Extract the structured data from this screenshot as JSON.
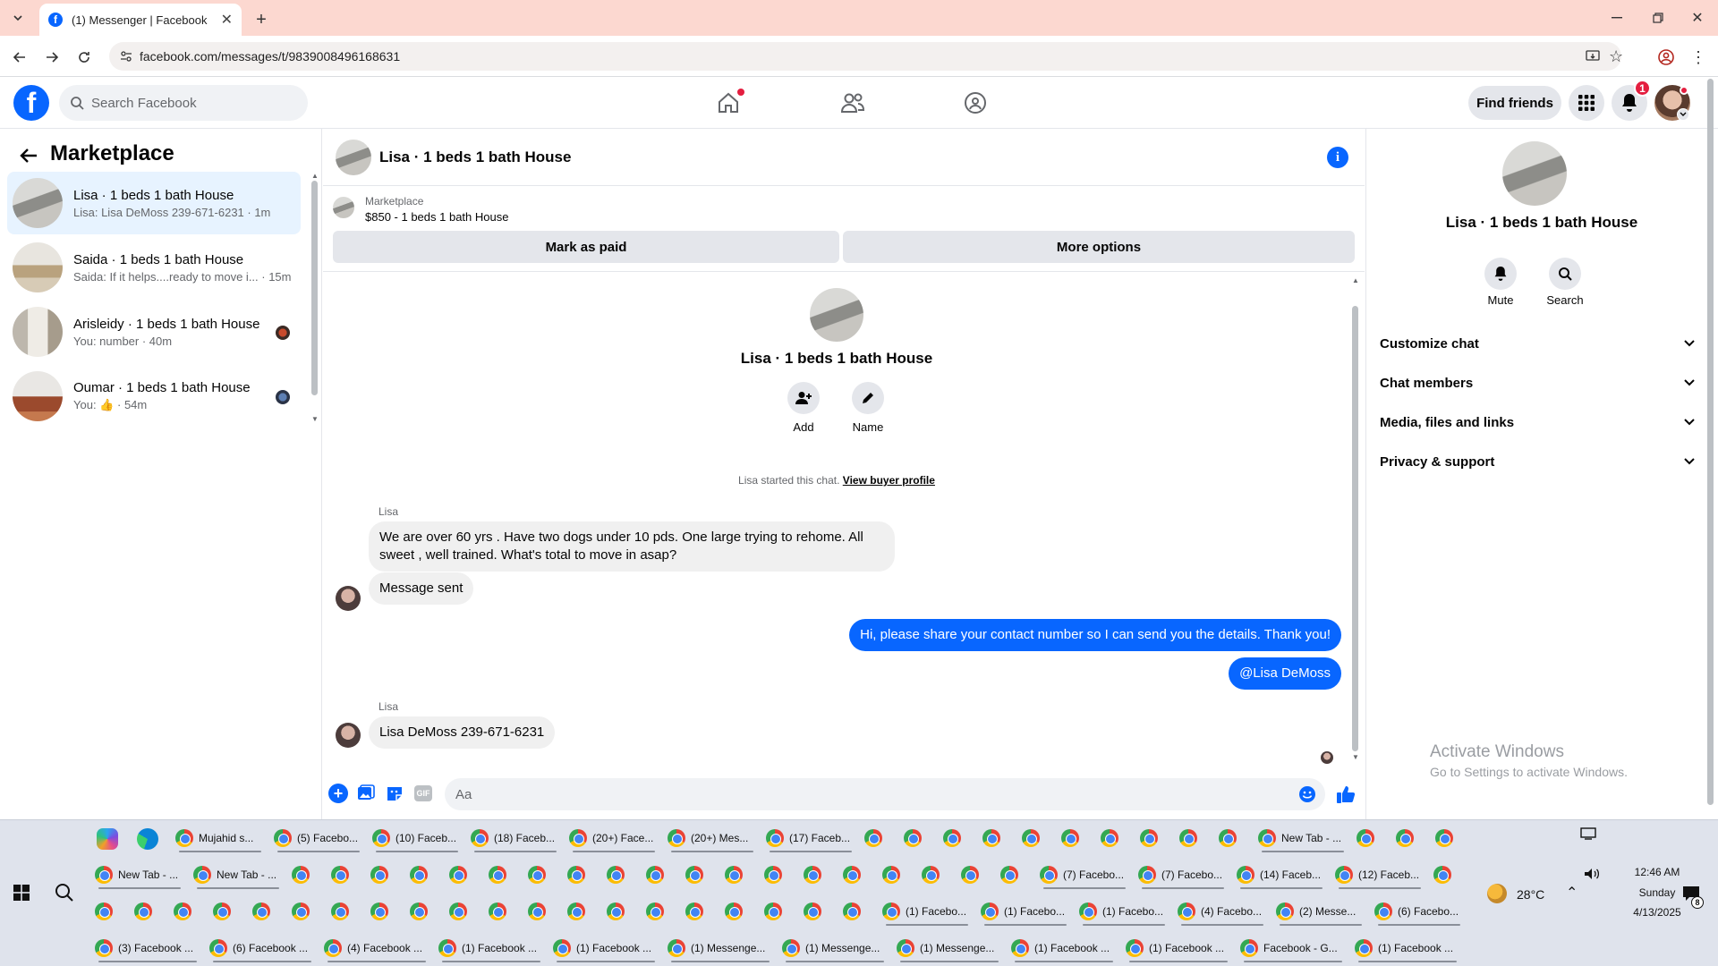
{
  "browser": {
    "tab_title": "(1) Messenger | Facebook",
    "url": "facebook.com/messages/t/9839008496168631"
  },
  "fb": {
    "search_placeholder": "Search Facebook",
    "find_friends": "Find friends",
    "notification_count": "1"
  },
  "left": {
    "title": "Marketplace",
    "conversations": [
      {
        "name": "Lisa · 1 beds 1 bath House",
        "preview": "Lisa: Lisa DeMoss 239-671-6231 · 1m"
      },
      {
        "name": "Saida · 1 beds 1 bath House",
        "preview": "Saida: If it helps....ready to move i... · 15m"
      },
      {
        "name": "Arisleidy · 1 beds 1 bath House",
        "preview": "You: number · 40m"
      },
      {
        "name": "Oumar · 1 beds 1 bath House",
        "preview_prefix": "You:",
        "preview_suffix": "· 54m"
      }
    ]
  },
  "chat": {
    "title": "Lisa · 1 beds 1 bath House",
    "marketplace_label": "Marketplace",
    "listing": "$850 - 1 beds 1 bath House",
    "mark_paid": "Mark as paid",
    "more_options": "More options",
    "intro_name": "Lisa · 1 beds 1 bath House",
    "add_label": "Add",
    "name_label": "Name",
    "started_text": "Lisa started this chat.",
    "view_buyer": "View buyer profile",
    "messages": [
      {
        "sender": "Lisa",
        "text": "We are over 60 yrs . Have two dogs under 10 pds. One large trying to rehome. All sweet , well trained. What's total to move in asap?"
      },
      {
        "text": "Message sent"
      },
      {
        "text": "Hi, please share your contact number so I can send you the details. Thank you!"
      },
      {
        "text": "@Lisa DeMoss"
      },
      {
        "sender": "Lisa",
        "text": "Lisa DeMoss 239-671-6231"
      }
    ],
    "input_placeholder": "Aa"
  },
  "right": {
    "name": "Lisa · 1 beds 1 bath House",
    "mute": "Mute",
    "search": "Search",
    "rows": [
      "Customize chat",
      "Chat members",
      "Media, files and links",
      "Privacy & support"
    ],
    "watermark_title": "Activate Windows",
    "watermark_sub": "Go to Settings to activate Windows."
  },
  "taskbar": {
    "row1": [
      "Mujahid s...",
      "(5) Facebo...",
      "(10) Faceb...",
      "(18) Faceb...",
      "(20+) Face...",
      "(20+) Mes...",
      "(17) Faceb...",
      "New Tab - ..."
    ],
    "row2": [
      "New Tab - ...",
      "New Tab - ...",
      "(7) Facebo...",
      "(7) Facebo...",
      "(14) Faceb...",
      "(12) Faceb..."
    ],
    "row3": [
      "(1) Facebo...",
      "(1) Facebo...",
      "(1) Facebo...",
      "(4) Facebo...",
      "(2) Messe...",
      "(6) Facebo..."
    ],
    "row4": [
      "(3) Facebook ...",
      "(6) Facebook ...",
      "(4) Facebook ...",
      "(1) Facebook ...",
      "(1) Facebook ...",
      "(1) Messenge...",
      "(1) Messenge...",
      "(1) Messenge...",
      "(1) Facebook ...",
      "(1) Facebook ...",
      "Facebook - G...",
      "(1) Facebook ..."
    ],
    "temp": "28°C",
    "time": "12:46 AM",
    "day": "Sunday",
    "date": "4/13/2025",
    "notif_count": "8"
  },
  "colors": {
    "fb_blue": "#0866ff",
    "tab_strip": "#fcd8d0",
    "active_row": "#e7f3ff",
    "badge_red": "#e41e3f"
  }
}
